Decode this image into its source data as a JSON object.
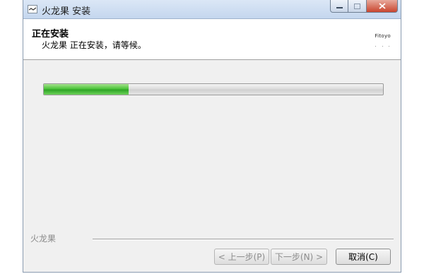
{
  "window": {
    "title": "火龙果 安装"
  },
  "header": {
    "title": "正在安装",
    "subtitle": "火龙果 正在安装，请等候。",
    "logo_text": "Fitoyo"
  },
  "progress": {
    "value_percent": 25,
    "fill_color": "#3bb52e"
  },
  "footer": {
    "brand": "火龙果"
  },
  "buttons": {
    "back": "< 上一步(P)",
    "next": "下一步(N) >",
    "cancel": "取消(C)"
  }
}
